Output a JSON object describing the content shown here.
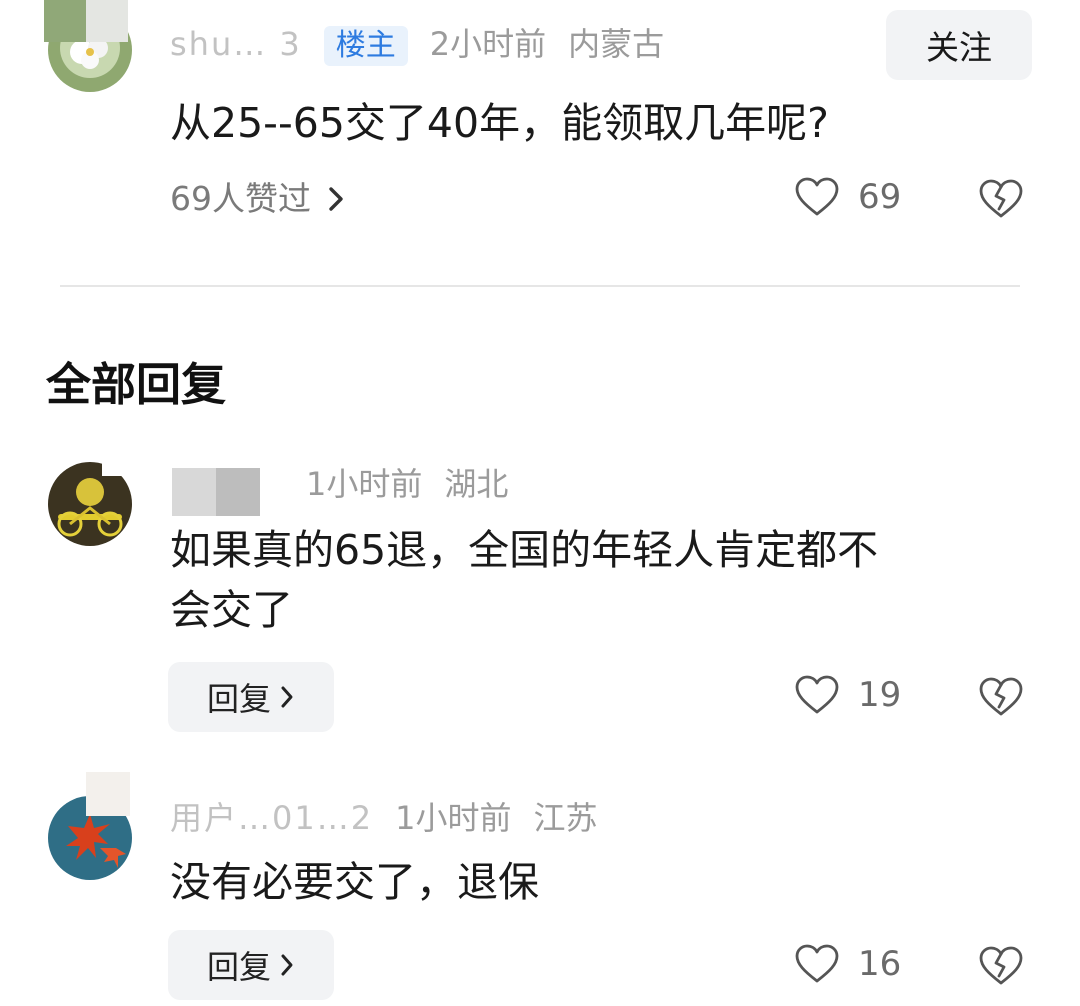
{
  "main_comment": {
    "username": "shu… 3",
    "op_badge": "楼主",
    "time": "2小时前",
    "location": "内蒙古",
    "follow_label": "关注",
    "text": "从25--65交了40年，能领取几年呢?",
    "likes_link": "69人赞过",
    "like_count": "69"
  },
  "section_title": "全部回复",
  "replies": [
    {
      "username": "",
      "time": "1小时前",
      "location": "湖北",
      "text_line1": "如果真的65退，全国的年轻人肯定都不",
      "text_line2": "会交了",
      "reply_label": "回复",
      "like_count": "19"
    },
    {
      "username": "用户…01…2",
      "time": "1小时前",
      "location": "江苏",
      "text_line1": "没有必要交了，退保",
      "reply_label": "回复",
      "like_count": "16"
    }
  ],
  "colors": {
    "badge_bg": "#e9f2fc",
    "badge_text": "#2d7be0",
    "button_bg": "#f2f3f5",
    "meta_text": "#9b9b9b"
  },
  "icons": [
    "heart-outline-icon",
    "broken-heart-icon",
    "chevron-right-icon"
  ]
}
